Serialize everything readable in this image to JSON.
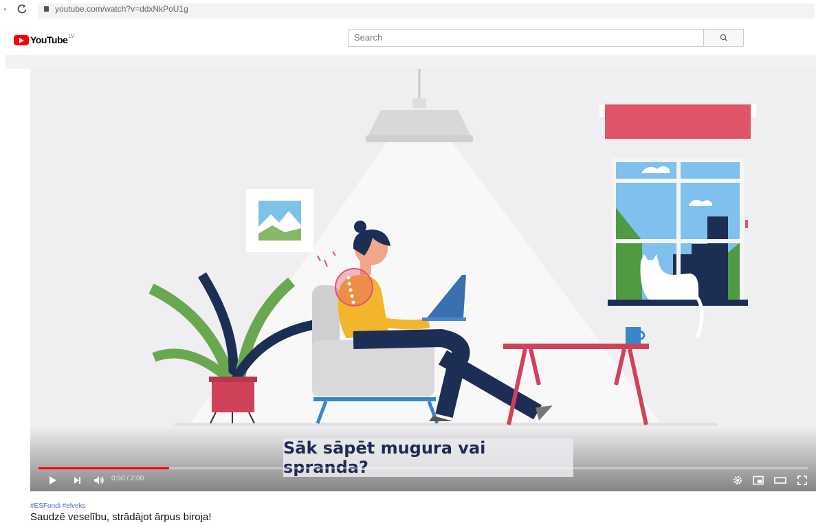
{
  "browser": {
    "url": "youtube.com/watch?v=ddxNkPoU1g",
    "reload_icon": "reload-icon",
    "lock_icon": "lock-icon"
  },
  "header": {
    "logo_text": "YouTube",
    "logo_suffix": "LV",
    "search_placeholder": "Search",
    "search_icon": "search-icon"
  },
  "video": {
    "subtitle": "Sāk sāpēt mugura vai spranda?",
    "time": "0:50 / 2:00",
    "progress": 0.17,
    "accent_color": "#ff0000",
    "controls": [
      "play-icon",
      "next-icon",
      "volume-icon",
      "settings-icon",
      "miniplayer-icon",
      "theater-icon",
      "fullscreen-icon"
    ]
  },
  "meta": {
    "hashtag": "#ESFondi #elveks",
    "title": "Saudzē veselību, strādājot ārpus biroja!"
  }
}
